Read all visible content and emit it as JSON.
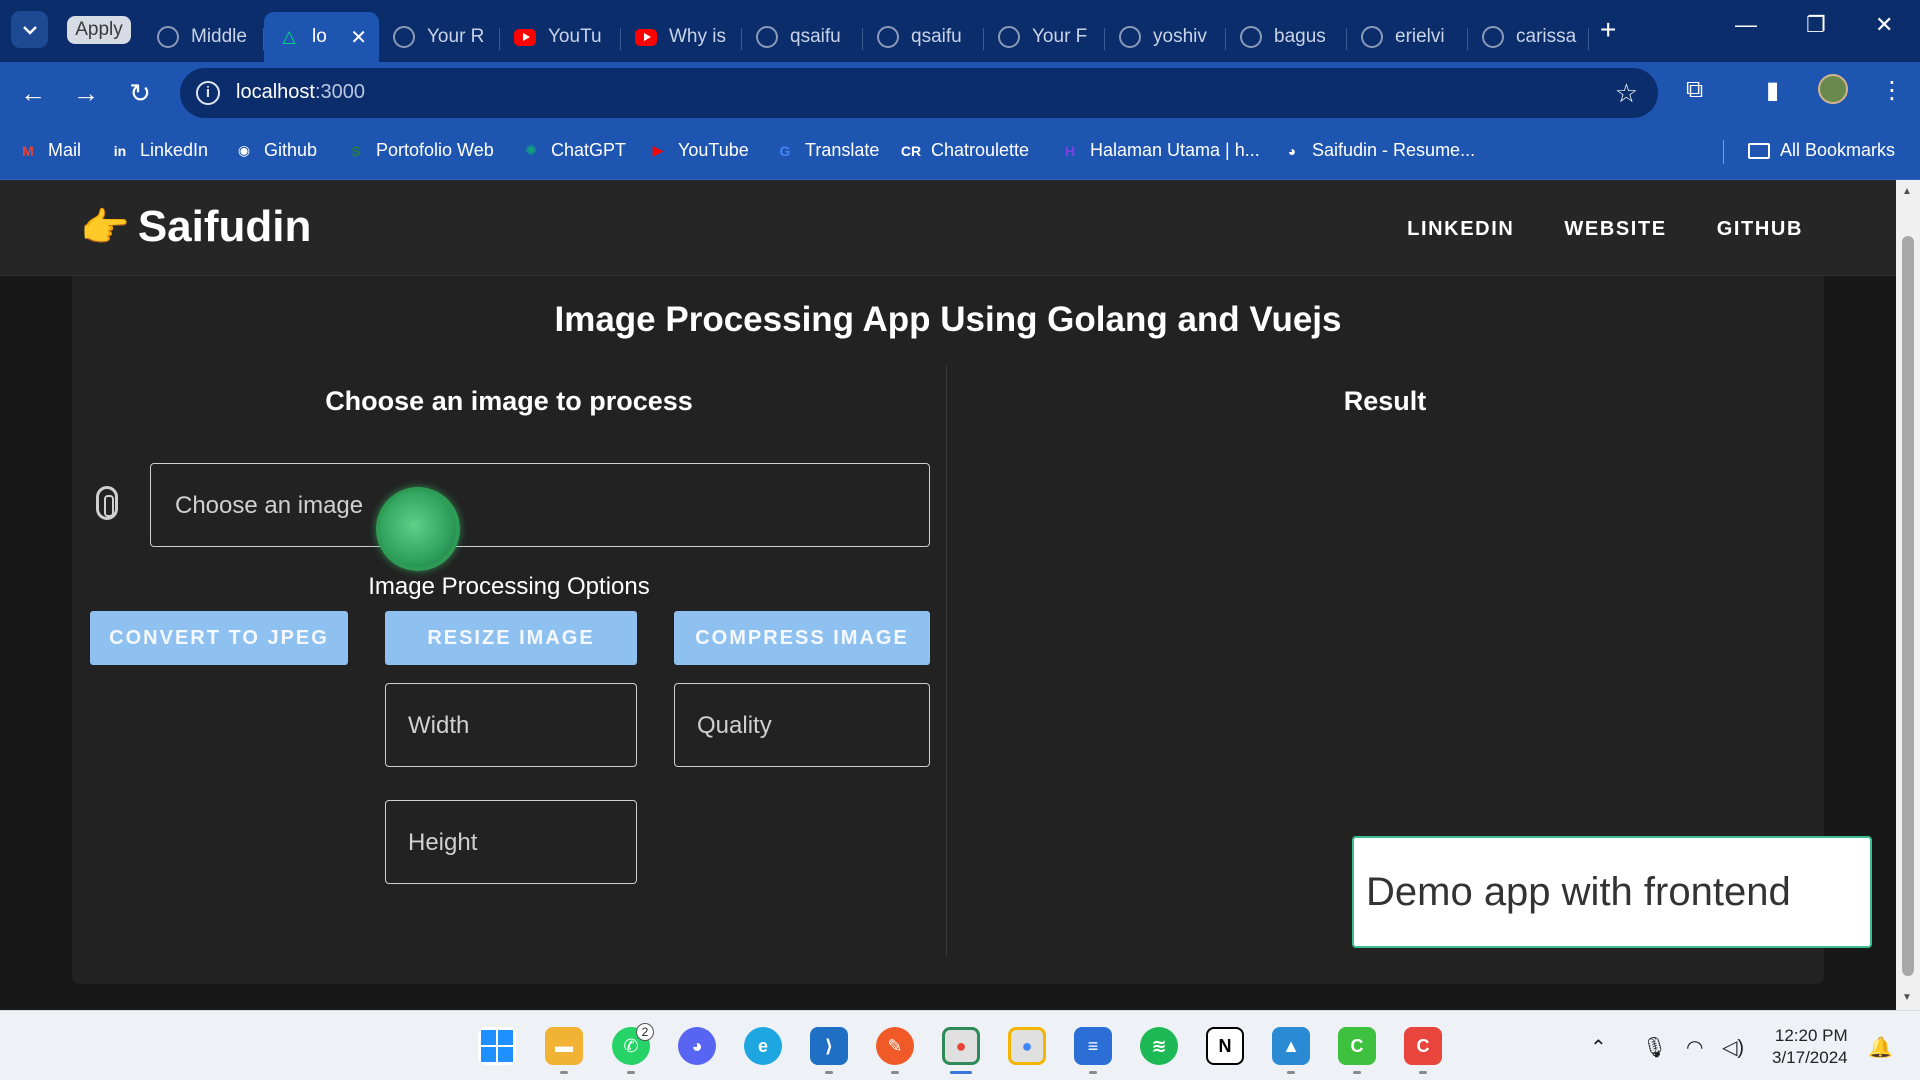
{
  "browser": {
    "apply_chip": "Apply",
    "tabs": [
      {
        "title": "Middle",
        "icon": "github-icon",
        "type": "gh"
      },
      {
        "title": "lo",
        "icon": "nuxt-icon",
        "type": "nuxt",
        "active": true
      },
      {
        "title": "Your R",
        "icon": "github-icon",
        "type": "gh"
      },
      {
        "title": "YouTu",
        "icon": "youtube-icon",
        "type": "yt"
      },
      {
        "title": "Why is",
        "icon": "youtube-icon",
        "type": "yt"
      },
      {
        "title": "qsaifu",
        "icon": "github-icon",
        "type": "gh"
      },
      {
        "title": "qsaifu",
        "icon": "github-icon",
        "type": "gh"
      },
      {
        "title": "Your F",
        "icon": "github-icon",
        "type": "gh"
      },
      {
        "title": "yoshiv",
        "icon": "github-icon",
        "type": "gh"
      },
      {
        "title": "bagus",
        "icon": "github-icon",
        "type": "gh"
      },
      {
        "title": "erielvi",
        "icon": "github-icon",
        "type": "gh"
      },
      {
        "title": "carissa",
        "icon": "github-icon",
        "type": "gh"
      }
    ],
    "url_host": "localhost",
    "url_port": ":3000",
    "bookmarks": [
      {
        "label": "Mail",
        "icon": "gmail-icon",
        "glyph": "M",
        "color": "#ea4335"
      },
      {
        "label": "LinkedIn",
        "icon": "linkedin-icon",
        "glyph": "in",
        "color": "#ffffff"
      },
      {
        "label": "Github",
        "icon": "github-icon",
        "glyph": "◉",
        "color": "#ffffff"
      },
      {
        "label": "Portofolio Web",
        "icon": "portfolio-icon",
        "glyph": "S",
        "color": "#2a7a3a"
      },
      {
        "label": "ChatGPT",
        "icon": "chatgpt-icon",
        "glyph": "✺",
        "color": "#10a37f"
      },
      {
        "label": "YouTube",
        "icon": "youtube-icon",
        "glyph": "▶",
        "color": "#ff0000"
      },
      {
        "label": "Translate",
        "icon": "translate-icon",
        "glyph": "G",
        "color": "#4285f4"
      },
      {
        "label": "Chatroulette",
        "icon": "chatroulette-icon",
        "glyph": "CR",
        "color": "#ffffff"
      },
      {
        "label": "Halaman Utama | h...",
        "icon": "halaman-icon",
        "glyph": "H",
        "color": "#7b3fe4"
      },
      {
        "label": "Saifudin - Resume...",
        "icon": "globe-icon",
        "glyph": "◕",
        "color": "#ffffff"
      }
    ],
    "all_bookmarks": "All Bookmarks"
  },
  "app": {
    "brand": "Saifudin",
    "brand_icon": "pointing-hand-icon",
    "nav": [
      "LINKEDIN",
      "WEBSITE",
      "GITHUB"
    ],
    "title": "Image Processing App Using Golang and Vuejs",
    "left_title": "Choose an image to process",
    "right_title": "Result",
    "file_placeholder": "Choose an image",
    "options_label": "Image Processing Options",
    "buttons": {
      "convert": "CONVERT TO JPEG",
      "resize": "RESIZE IMAGE",
      "compress": "COMPRESS IMAGE"
    },
    "fields": {
      "width": "Width",
      "height": "Height",
      "quality": "Quality"
    },
    "caption": "Demo app with frontend"
  },
  "taskbar": {
    "whatsapp_badge": "2",
    "time": "12:20 PM",
    "date": "3/17/2024"
  },
  "colors": {
    "browser_frame": "#0c2d6b",
    "toolbar": "#1e55b0",
    "button": "#8ec0f0",
    "page_bg": "#181818",
    "card_bg": "#222222"
  }
}
